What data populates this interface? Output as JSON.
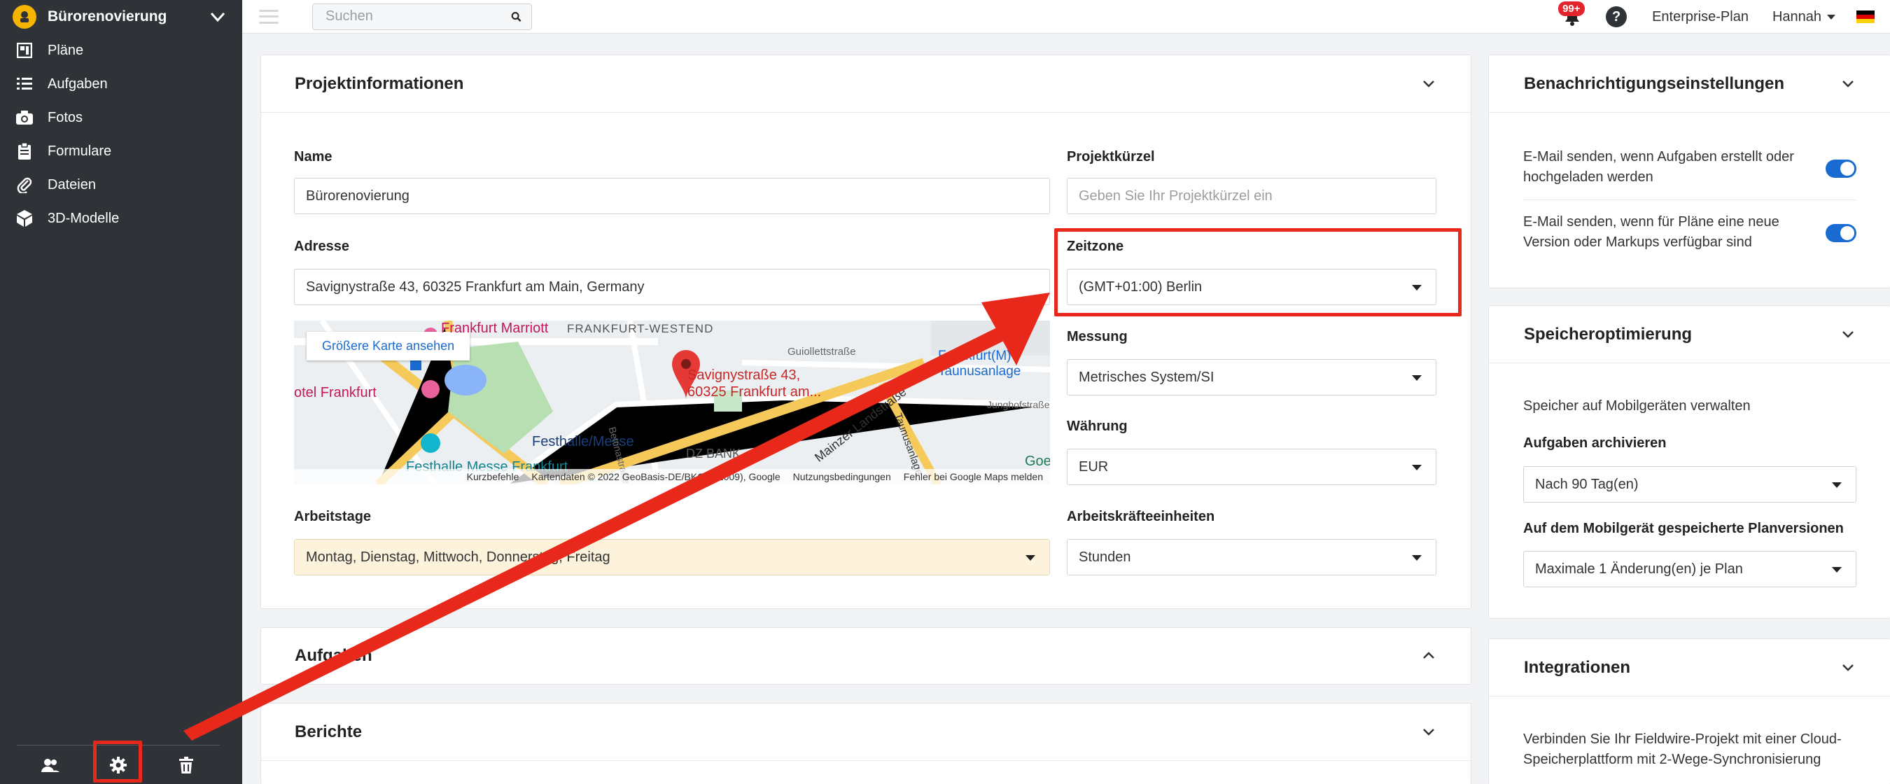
{
  "sidebar": {
    "project_name": "Bürorenovierung",
    "items": [
      {
        "label": "Pläne",
        "icon": "plans-icon"
      },
      {
        "label": "Aufgaben",
        "icon": "list-icon"
      },
      {
        "label": "Fotos",
        "icon": "camera-icon"
      },
      {
        "label": "Formulare",
        "icon": "clipboard-icon"
      },
      {
        "label": "Dateien",
        "icon": "paperclip-icon"
      },
      {
        "label": "3D-Modelle",
        "icon": "cube-icon"
      }
    ],
    "bottom_icons": [
      "users-icon",
      "gear-icon",
      "trash-icon"
    ]
  },
  "topbar": {
    "search_placeholder": "Suchen",
    "notification_count": "99+",
    "plan": "Enterprise-Plan",
    "user": "Hannah"
  },
  "project_info": {
    "title": "Projektinformationen",
    "name_label": "Name",
    "name_value": "Bürorenovierung",
    "code_label": "Projektkürzel",
    "code_placeholder": "Geben Sie Ihr Projektkürzel ein",
    "address_label": "Adresse",
    "address_value": "Savignystraße 43, 60325 Frankfurt am Main, Germany",
    "timezone_label": "Zeitzone",
    "timezone_value": "(GMT+01:00) Berlin",
    "measure_label": "Messung",
    "measure_value": "Metrisches System/SI",
    "currency_label": "Währung",
    "currency_value": "EUR",
    "workdays_label": "Arbeitstage",
    "workdays_value": "Montag, Dienstag, Mittwoch, Donnerstag, Freitag",
    "labor_label": "Arbeitskräfteeinheiten",
    "labor_value": "Stunden",
    "map": {
      "larger_map": "Größere Karte ansehen",
      "pin_label_1": "Savignystraße 43,",
      "pin_label_2": "60325 Frankfurt am...",
      "labels": [
        "Frankfurt Marriott",
        "FRANKFURT-WESTEND",
        "Guiollettstraße",
        "otel Frankfurt",
        "Festhalle/Messe",
        "Festhalle Messe Frankfurt",
        "Frankfurt(M) Taunusanlage",
        "Junghofstraße",
        "Bettinastraße",
        "Taunusanlage",
        "Mainzer Landstraße",
        "DZ BANK",
        "Goe"
      ],
      "footer": [
        "Kurzbefehle",
        "Kartendaten © 2022 GeoBasis-DE/BKG (©2009), Google",
        "Nutzungsbedingungen",
        "Fehler bei Google Maps melden"
      ]
    }
  },
  "tasks_card": {
    "title": "Aufgaben"
  },
  "reports_card": {
    "title": "Berichte"
  },
  "notifications": {
    "title": "Benachrichtigungseinstellungen",
    "item1": [
      "E-Mail senden, wenn Aufgaben erstellt oder",
      "hochgeladen werden"
    ],
    "item2": [
      "E-Mail senden, wenn für Pläne eine neue",
      "Version oder Markups verfügbar sind"
    ]
  },
  "storage": {
    "title": "Speicheroptimierung",
    "subtitle": "Speicher auf Mobilgeräten verwalten",
    "archive_label": "Aufgaben archivieren",
    "archive_value": "Nach 90 Tag(en)",
    "versions_label": "Auf dem Mobilgerät gespeicherte Planversionen",
    "versions_value": "Maximale 1 Änderung(en) je Plan"
  },
  "integrations": {
    "title": "Integrationen",
    "text": [
      "Verbinden Sie Ihr Fieldwire-Projekt mit einer Cloud-",
      "Speicherplattform mit 2-Wege-Synchronisierung"
    ]
  },
  "colors": {
    "sidebar": "#2f3237",
    "accent": "#1a6bd1",
    "highlight": "#e8281a",
    "logo": "#f5b400"
  }
}
